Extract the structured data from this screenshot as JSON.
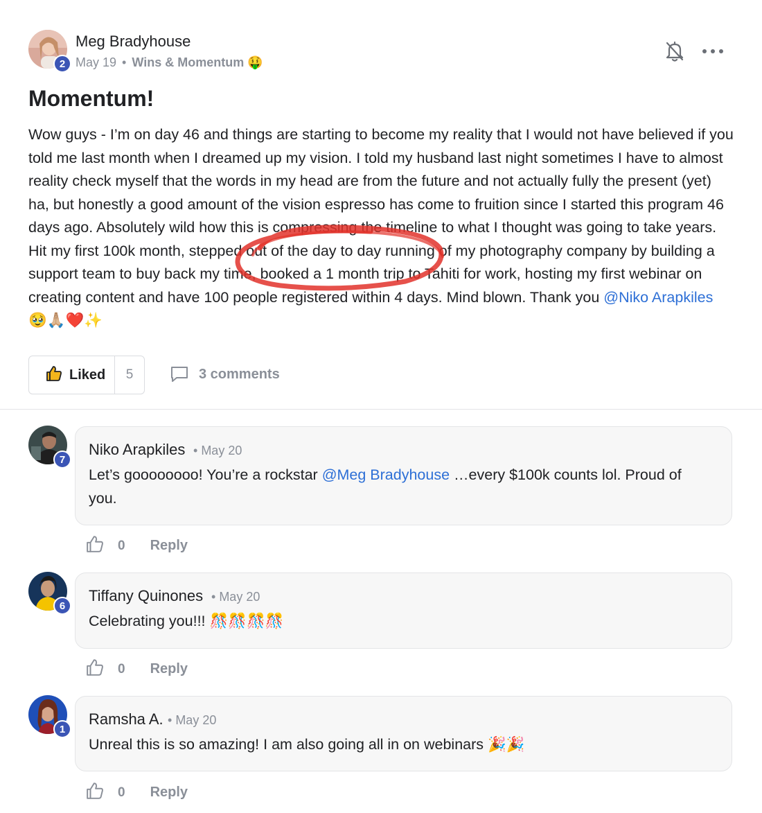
{
  "post": {
    "author": "Meg Bradyhouse",
    "author_level": "2",
    "date": "May 19",
    "separator": "•",
    "category": "Wins & Momentum 🤑",
    "title": "Momentum!",
    "body_pre": "Wow guys - I’m on day 46 and things are starting to become my reality that I would not have believed if you told me last month when I dreamed up my vision. I told my husband last night sometimes I have to almost reality check myself that the words in my head are from the future and not actually fully the present (yet) ha, but honestly a good amount of the vision espresso has come to fruition since I started this program 46 days ago. Absolutely wild how this is compressing the timeline to what I thought was going to take years. Hit my first 100k month, stepped out of the day to day running of my photography company by building a support team to buy back my time, booked a 1 month trip to Tahiti for work, hosting my first webinar on creating content and have 100 people registered within 4 days. Mind blown. Thank you ",
    "body_mention": "@Niko Arapkiles",
    "body_post": " 🥹🙏🏼❤️✨",
    "like_label": "Liked",
    "like_count": "5",
    "comments_label": "3 comments"
  },
  "comments": [
    {
      "name": "Niko Arapkiles",
      "level": "7",
      "date": "May 20",
      "text_pre": "Let’s goooooooo! You’re a rockstar ",
      "mention": "@Meg Bradyhouse",
      "text_post": " …every $100k counts lol. Proud of you.",
      "likes": "0",
      "reply_label": "Reply"
    },
    {
      "name": "Tiffany Quinones",
      "level": "6",
      "date": "May 20",
      "text": "Celebrating you!!! 🎊🎊🎊🎊",
      "likes": "0",
      "reply_label": "Reply"
    },
    {
      "name": "Ramsha A.",
      "level": "1",
      "date": "May 20",
      "text": "Unreal this is so amazing! I am also going all in on webinars 🎉🎉",
      "likes": "0",
      "reply_label": "Reply"
    }
  ],
  "colors": {
    "mention": "#2d6fd6",
    "level_badge": "#3b55b5",
    "annotation_circle": "#e2332b",
    "muted_text": "#8a8f98"
  },
  "icons": [
    "bell-off-icon",
    "more-icon",
    "thumbs-up-icon",
    "comment-icon"
  ]
}
